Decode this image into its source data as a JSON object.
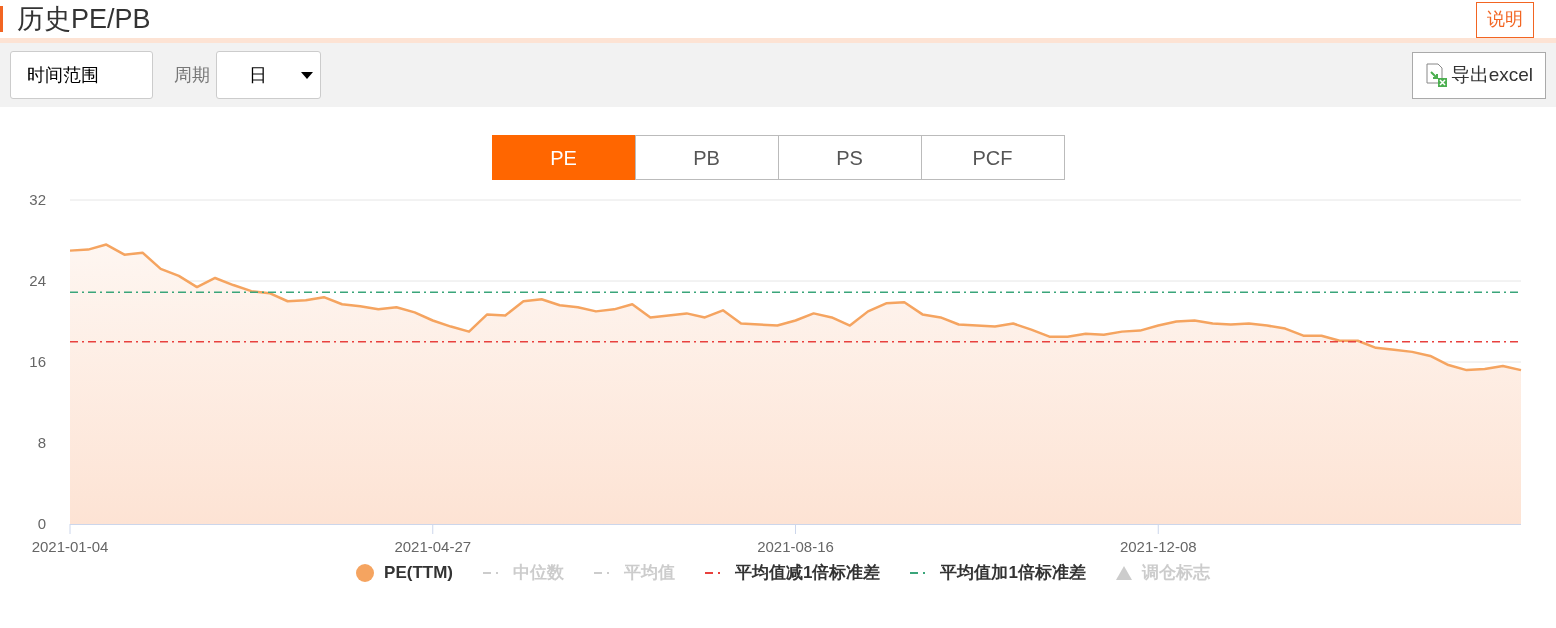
{
  "header": {
    "title": "历史PE/PB",
    "help_button": "说明"
  },
  "toolbar": {
    "range_button": "时间范围",
    "period_label": "周期",
    "period_select": {
      "value": "日"
    },
    "export_button": "导出excel"
  },
  "tabs": [
    {
      "label": "PE",
      "selected": true
    },
    {
      "label": "PB",
      "selected": false
    },
    {
      "label": "PS",
      "selected": false
    },
    {
      "label": "PCF",
      "selected": false
    }
  ],
  "chart_data": {
    "type": "area",
    "categories": [
      "2021-01-04",
      null,
      null,
      null,
      null,
      null,
      null,
      null,
      null,
      null,
      null,
      null,
      null,
      null,
      null,
      null,
      null,
      null,
      null,
      null,
      "2021-04-27",
      null,
      null,
      null,
      null,
      null,
      null,
      null,
      null,
      null,
      null,
      null,
      null,
      null,
      null,
      null,
      null,
      null,
      null,
      null,
      "2021-08-16",
      null,
      null,
      null,
      null,
      null,
      null,
      null,
      null,
      null,
      null,
      null,
      null,
      null,
      null,
      null,
      null,
      null,
      null,
      null,
      "2021-12-08",
      null,
      null,
      null,
      null,
      null,
      null,
      null,
      null,
      null,
      null,
      null,
      null,
      null,
      null,
      null,
      null,
      null,
      null,
      null,
      null
    ],
    "ylim": [
      0,
      32
    ],
    "yticks": [
      0,
      8,
      16,
      24,
      32
    ],
    "series": [
      {
        "name": "PE(TTM)",
        "color": "#f5a460",
        "values": [
          27.0,
          27.1,
          27.6,
          26.6,
          26.8,
          25.2,
          24.5,
          23.4,
          24.3,
          23.6,
          23.0,
          22.8,
          22.0,
          22.1,
          22.4,
          21.7,
          21.5,
          21.2,
          21.4,
          20.9,
          20.1,
          19.5,
          19.0,
          20.7,
          20.6,
          22.0,
          22.2,
          21.6,
          21.4,
          21.0,
          21.2,
          21.7,
          20.4,
          20.6,
          20.8,
          20.4,
          21.1,
          19.8,
          19.7,
          19.6,
          20.1,
          20.8,
          20.4,
          19.6,
          21.0,
          21.8,
          21.9,
          20.7,
          20.4,
          19.7,
          19.6,
          19.5,
          19.8,
          19.2,
          18.5,
          18.5,
          18.8,
          18.7,
          19.0,
          19.1,
          19.6,
          20.0,
          20.1,
          19.8,
          19.7,
          19.8,
          19.6,
          19.3,
          18.6,
          18.6,
          18.1,
          18.1,
          17.4,
          17.2,
          17.0,
          16.6,
          15.7,
          15.2,
          15.3,
          15.6,
          15.2
        ]
      },
      {
        "name": "平均值减1倍标准差",
        "color": "#e8413e",
        "type": "line",
        "line_style": "dashdot",
        "values": [
          18.0,
          18.0,
          18.0,
          18.0,
          18.0,
          18.0,
          18.0,
          18.0,
          18.0,
          18.0,
          18.0,
          18.0,
          18.0,
          18.0,
          18.0,
          18.0,
          18.0,
          18.0,
          18.0,
          18.0,
          18.0,
          18.0,
          18.0,
          18.0,
          18.0,
          18.0,
          18.0,
          18.0,
          18.0,
          18.0,
          18.0,
          18.0,
          18.0,
          18.0,
          18.0,
          18.0,
          18.0,
          18.0,
          18.0,
          18.0,
          18.0,
          18.0,
          18.0,
          18.0,
          18.0,
          18.0,
          18.0,
          18.0,
          18.0,
          18.0,
          18.0,
          18.0,
          18.0,
          18.0,
          18.0,
          18.0,
          18.0,
          18.0,
          18.0,
          18.0,
          18.0,
          18.0,
          18.0,
          18.0,
          18.0,
          18.0,
          18.0,
          18.0,
          18.0,
          18.0,
          18.0,
          18.0,
          18.0,
          18.0,
          18.0,
          18.0,
          18.0,
          18.0,
          18.0,
          18.0,
          18.0
        ]
      },
      {
        "name": "平均值加1倍标准差",
        "color": "#3aa57a",
        "type": "line",
        "line_style": "dashdot",
        "values": [
          22.9,
          22.9,
          22.9,
          22.9,
          22.9,
          22.9,
          22.9,
          22.9,
          22.9,
          22.9,
          22.9,
          22.9,
          22.9,
          22.9,
          22.9,
          22.9,
          22.9,
          22.9,
          22.9,
          22.9,
          22.9,
          22.9,
          22.9,
          22.9,
          22.9,
          22.9,
          22.9,
          22.9,
          22.9,
          22.9,
          22.9,
          22.9,
          22.9,
          22.9,
          22.9,
          22.9,
          22.9,
          22.9,
          22.9,
          22.9,
          22.9,
          22.9,
          22.9,
          22.9,
          22.9,
          22.9,
          22.9,
          22.9,
          22.9,
          22.9,
          22.9,
          22.9,
          22.9,
          22.9,
          22.9,
          22.9,
          22.9,
          22.9,
          22.9,
          22.9,
          22.9,
          22.9,
          22.9,
          22.9,
          22.9,
          22.9,
          22.9,
          22.9,
          22.9,
          22.9,
          22.9,
          22.9,
          22.9,
          22.9,
          22.9,
          22.9,
          22.9,
          22.9,
          22.9,
          22.9,
          22.9
        ]
      }
    ]
  },
  "legend": [
    {
      "kind": "series"
    },
    {
      "label": "中位数",
      "kind": "dash",
      "color": "#cccccc",
      "active": false
    },
    {
      "label": "平均值",
      "kind": "dash",
      "color": "#cccccc",
      "active": false
    },
    {
      "kind": "series"
    },
    {
      "kind": "series"
    },
    {
      "label": "调仓标志",
      "kind": "triangle",
      "color": "#cccccc",
      "active": false
    }
  ]
}
